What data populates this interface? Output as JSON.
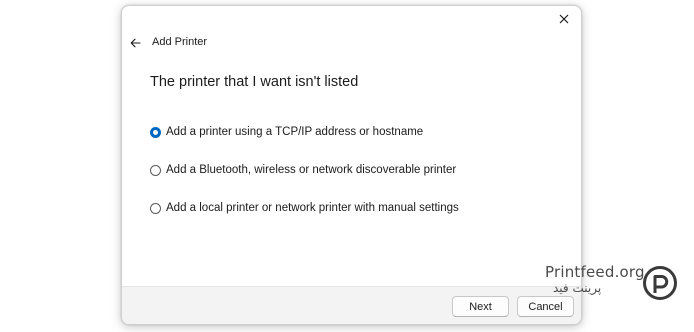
{
  "dialog": {
    "title": "Add Printer",
    "heading": "The printer that I want isn't listed",
    "options": [
      {
        "label": "Add a printer using a TCP/IP address or hostname",
        "selected": true
      },
      {
        "label": "Add a Bluetooth, wireless or network discoverable printer",
        "selected": false
      },
      {
        "label": "Add a local printer or network printer with manual settings",
        "selected": false
      }
    ],
    "buttons": {
      "next": "Next",
      "cancel": "Cancel"
    },
    "icons": {
      "close": "close-icon",
      "back": "back-arrow-icon"
    }
  },
  "watermark": {
    "latin": "Printfeed.org",
    "persian": "پرینت فید",
    "logo": "printfeed-logo"
  },
  "colors": {
    "accent": "#0067c0",
    "footer": "#f3f3f3",
    "logo": "#3a3a3a"
  }
}
